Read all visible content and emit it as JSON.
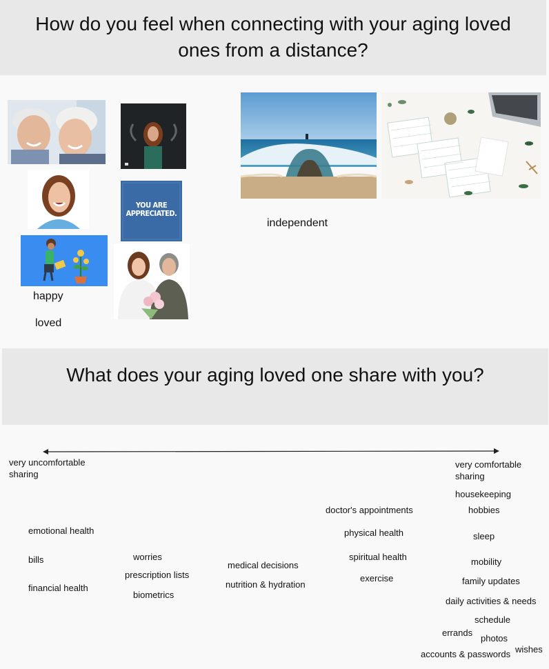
{
  "sections": {
    "feelings": {
      "title": "How do you feel when connecting with your aging loved ones from a distance?",
      "words": {
        "happy": "happy",
        "loved": "loved",
        "independent": "independent"
      },
      "poster_text": "YOU ARE APPRECIATED."
    },
    "sharing": {
      "title": "What does your aging loved one share with you?",
      "scale": {
        "left": "very uncomfortable sharing",
        "right": "very comfortable sharing"
      },
      "items": {
        "housekeeping": "housekeeping",
        "doctors_appointments": "doctor's appointments",
        "hobbies": "hobbies",
        "emotional_health": "emotional health",
        "physical_health": "physical health",
        "sleep": "sleep",
        "bills": "bills",
        "worries": "worries",
        "spiritual_health": "spiritual health",
        "mobility": "mobility",
        "medical_decisions": "medical decisions",
        "prescription_lists": "prescription lists",
        "exercise": "exercise",
        "family_updates": "family updates",
        "financial_health": "financial health",
        "nutrition_hydration": "nutrition & hydration",
        "biometrics": "biometrics",
        "daily_activities": "daily activities & needs",
        "schedule": "schedule",
        "errands": "errands",
        "photos": "photos",
        "wishes": "wishes",
        "accounts_passwords": "accounts & passwords"
      }
    }
  }
}
